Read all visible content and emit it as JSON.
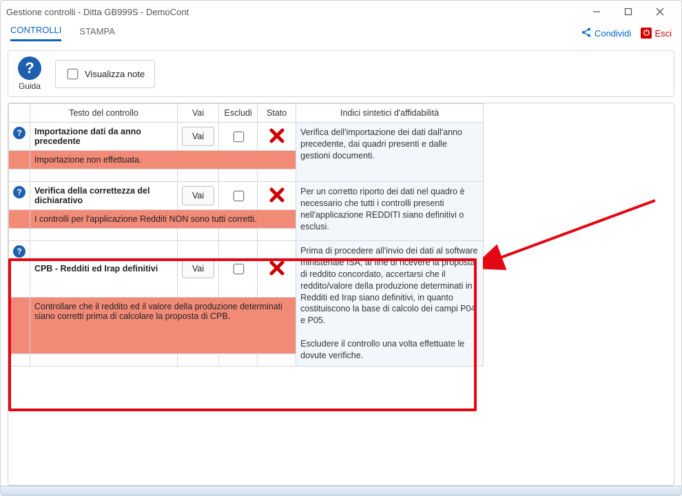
{
  "window": {
    "title": "Gestione controlli - Ditta GB999S - DemoCont"
  },
  "tabs": {
    "controlli": "CONTROLLI",
    "stampa": "STAMPA"
  },
  "top_actions": {
    "share": "Condividi",
    "exit": "Esci",
    "exit_glyph": "⏻"
  },
  "toolbar": {
    "guide_label": "Guida",
    "visualizza_note": "Visualizza note"
  },
  "headers": {
    "testo": "Testo del controllo",
    "vai": "Vai",
    "escludi": "Escludi",
    "stato": "Stato",
    "indici": "Indici sintetici d'affidabilità"
  },
  "vai_button": "Vai",
  "rows": [
    {
      "title": "Importazione dati da anno precedente",
      "desc": "Verifica dell'importazione dei dati dall'anno precedente, dai quadri presenti e dalle gestioni documenti.",
      "error": "Importazione non effettuata.",
      "excluded": false,
      "status": "fail"
    },
    {
      "title": "Verifica della correttezza del dichiarativo",
      "desc": "Per un corretto riporto dei dati nel quadro è necessario che tutti i controlli presenti nell'applicazione REDDITI siano definitivi o esclusi.",
      "error": "I controlli per l'applicazione Redditi NON sono tutti corretti.",
      "excluded": false,
      "status": "fail"
    },
    {
      "title": "CPB - Redditi ed Irap definitivi",
      "desc": "Prima di procedere all'invio dei dati al software ministeriale ISA, al fine di ricevere la proposta di reddito concordato, accertarsi che il reddito/valore della produzione determinati in Redditi ed Irap siano definitivi, in quanto costituiscono la base di calcolo dei campi P04 e P05.\n\nEscludere il controllo una volta effettuate le dovute verifiche.",
      "error": "Controllare che il reddito ed il valore della produzione determinati siano corretti prima di calcolare la proposta di CPB.",
      "excluded": false,
      "status": "fail"
    }
  ]
}
